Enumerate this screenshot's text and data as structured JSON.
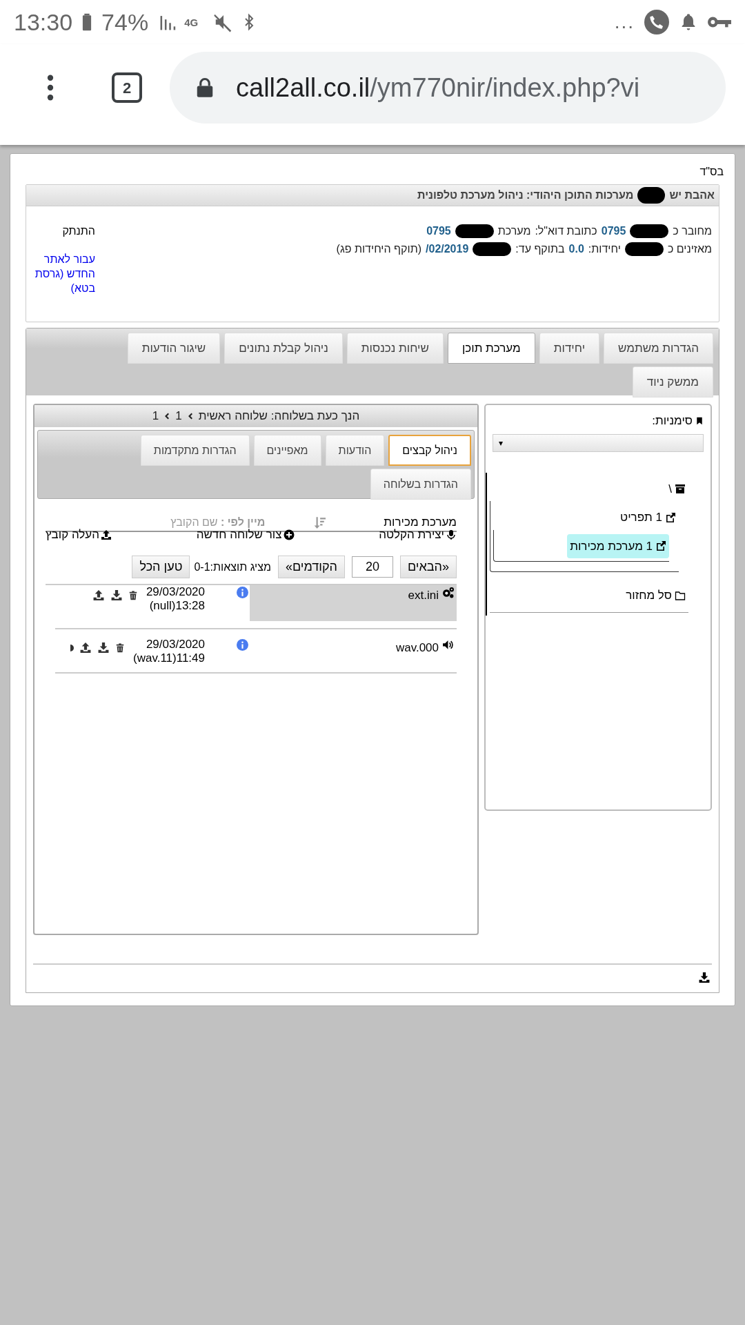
{
  "status_bar": {
    "time": "13:30",
    "battery": "74%",
    "network": "4G",
    "more": "..."
  },
  "browser": {
    "tab_count": "2",
    "url_host": "call2all.co.il",
    "url_path": "/ym770nir/index.php?vi"
  },
  "blessing": "בס\"ד",
  "header": {
    "title_parts": [
      "אהבת יש",
      "מערכות התוכן היהודי: ניהול מערכת טלפונית"
    ],
    "info_lines": [
      [
        {
          "kind": "text",
          "text": "מחובר כ"
        },
        {
          "kind": "redacted"
        },
        {
          "kind": "value",
          "text": "0795"
        },
        {
          "kind": "text",
          "text": "כתובת דוא\"ל:"
        },
        {
          "kind": "text",
          "text": "מערכת"
        },
        {
          "kind": "redacted"
        },
        {
          "kind": "value",
          "text": "0795"
        }
      ],
      [
        {
          "kind": "text",
          "text": "מאזינים כ"
        },
        {
          "kind": "redacted"
        },
        {
          "kind": "text",
          "text": "יחידות:"
        },
        {
          "kind": "value",
          "text": "0.0"
        },
        {
          "kind": "text",
          "text": "בתוקף עד:"
        },
        {
          "kind": "redacted"
        },
        {
          "kind": "value",
          "text": "/02/2019"
        },
        {
          "kind": "text",
          "text": "(תוקף היחידות פג)"
        }
      ]
    ],
    "logout": "התנתק",
    "new_site_link": "עבור לאתר החדש (גרסת בטא)"
  },
  "main_tabs": [
    {
      "label": "הגדרות משתמש",
      "selected": false
    },
    {
      "label": "יחידות",
      "selected": false
    },
    {
      "label": "מערכת תוכן",
      "selected": true
    },
    {
      "label": "שיחות נכנסות",
      "selected": false
    },
    {
      "label": "ניהול קבלת נתונים",
      "selected": false
    },
    {
      "label": "שיגור הודעות",
      "selected": false
    },
    {
      "label": "ממשק ניוד",
      "selected": false
    }
  ],
  "bookmarks": {
    "label": "סימניות:",
    "dropdown_arrow": "▾"
  },
  "tree": [
    {
      "label": "\\",
      "kind": "root",
      "selected": false,
      "children": [
        {
          "label": "1 תפריט",
          "kind": "link",
          "selected": false,
          "children": [
            {
              "label": "1 מערכת מכירות",
              "kind": "link",
              "selected": true
            }
          ]
        }
      ]
    },
    {
      "label": "סל מחזור",
      "kind": "folder",
      "selected": false
    }
  ],
  "breadcrumb": [
    "הנך כעת בשלוחה: שלוחה ראשית",
    "1",
    "1"
  ],
  "sub_tabs": [
    {
      "label": "ניהול קבצים",
      "selected": true
    },
    {
      "label": "הודעות",
      "selected": false
    },
    {
      "label": "מאפיינים",
      "selected": false
    },
    {
      "label": "הגדרות מתקדמות",
      "selected": false
    },
    {
      "label": "הגדרות בשלוחה",
      "selected": false
    }
  ],
  "extension_name": "מערכת מכירות",
  "sort": {
    "label": "מיין לפי :",
    "value": "שם הקובץ"
  },
  "actions": [
    {
      "kind": "record",
      "label": "יצירת הקלטה"
    },
    {
      "kind": "new",
      "label": "צור שלוחה חדשה"
    },
    {
      "kind": "upload",
      "label": "העלה קובץ"
    }
  ],
  "pager": {
    "next": "«הבאים",
    "page_size": "20",
    "prev": "הקודמים»",
    "results": "מציג תוצאות:0-1",
    "load_all": "טען הכל"
  },
  "files": [
    {
      "kind": "ini",
      "name": "ext.ini",
      "date": "29/03/2020",
      "time": "(null)13:28",
      "selected": true
    },
    {
      "kind": "audio",
      "name": "wav.000",
      "date": "29/03/2020",
      "time": "(wav.11)11:49",
      "selected": false
    }
  ]
}
